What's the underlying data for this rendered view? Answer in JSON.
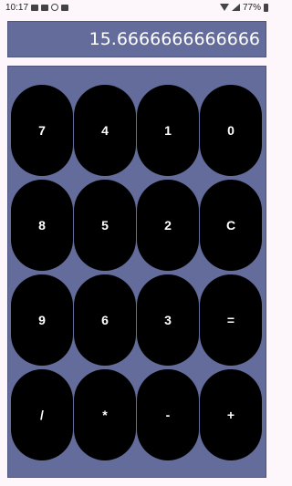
{
  "status_bar": {
    "time": "10:17",
    "battery_text": "77%"
  },
  "display": {
    "value": "15.6666666666666"
  },
  "keypad": {
    "keys": [
      [
        "7",
        "4",
        "1",
        "0"
      ],
      [
        "8",
        "5",
        "2",
        "C"
      ],
      [
        "9",
        "6",
        "3",
        "="
      ],
      [
        "/",
        "*",
        "-",
        "+"
      ]
    ]
  },
  "colors": {
    "panel": "#636c9a",
    "key": "#000000",
    "key_text": "#ffffff",
    "background": "#fdf7fc"
  },
  "icons": {
    "status_left": [
      "message-icon",
      "sim-icon",
      "media-icon",
      "notification-icon"
    ],
    "status_right": [
      "wifi-icon",
      "signal-icon",
      "battery-icon"
    ]
  }
}
